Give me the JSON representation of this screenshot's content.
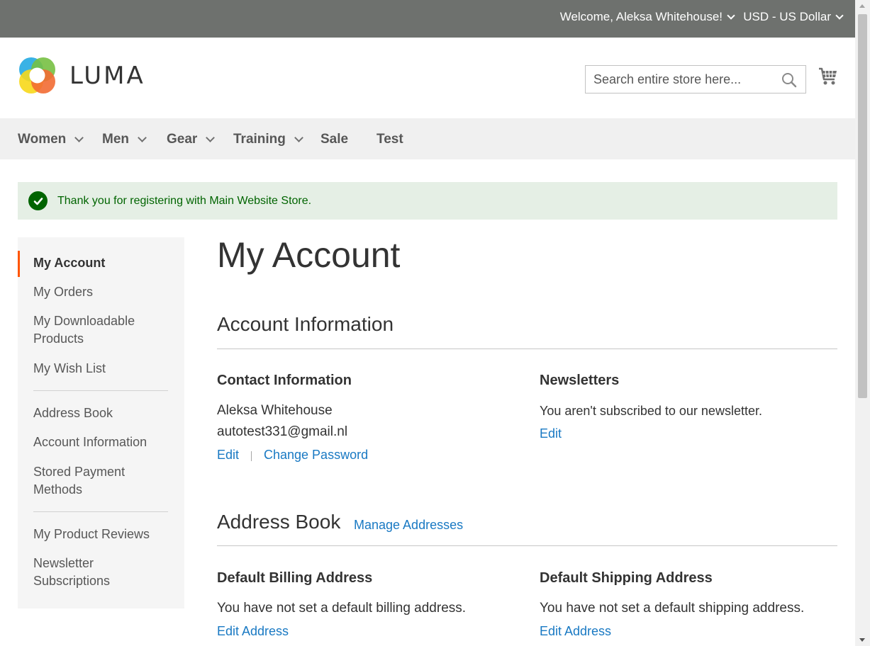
{
  "panel": {
    "welcome_label": "Welcome, Aleksa Whitehouse!",
    "currency_label": "USD - US Dollar"
  },
  "header": {
    "logo_text": "LUMA",
    "search_placeholder": "Search entire store here..."
  },
  "nav": {
    "items": [
      {
        "label": "Women"
      },
      {
        "label": "Men"
      },
      {
        "label": "Gear"
      },
      {
        "label": "Training"
      },
      {
        "label": "Sale"
      },
      {
        "label": "Test"
      }
    ]
  },
  "message": {
    "text": "Thank you for registering with Main Website Store."
  },
  "sidebar": {
    "items": [
      {
        "label": "My Account"
      },
      {
        "label": "My Orders"
      },
      {
        "label": "My Downloadable Products"
      },
      {
        "label": "My Wish List"
      },
      {
        "label": "Address Book"
      },
      {
        "label": "Account Information"
      },
      {
        "label": "Stored Payment Methods"
      },
      {
        "label": "My Product Reviews"
      },
      {
        "label": "Newsletter Subscriptions"
      }
    ]
  },
  "main": {
    "page_title": "My Account",
    "account_info": {
      "title": "Account Information",
      "contact": {
        "title": "Contact Information",
        "name": "Aleksa Whitehouse",
        "email": "autotest331@gmail.nl",
        "edit_label": "Edit",
        "change_password_label": "Change Password"
      },
      "newsletters": {
        "title": "Newsletters",
        "text": "You aren't subscribed to our newsletter.",
        "edit_label": "Edit"
      }
    },
    "address_book": {
      "title": "Address Book",
      "manage_label": "Manage Addresses",
      "billing": {
        "title": "Default Billing Address",
        "text": "You have not set a default billing address.",
        "edit_label": "Edit Address"
      },
      "shipping": {
        "title": "Default Shipping Address",
        "text": "You have not set a default shipping address.",
        "edit_label": "Edit Address"
      }
    }
  },
  "colors": {
    "panel_bg": "#6e716e",
    "link": "#1979c3",
    "success_bg": "#e5efe5",
    "success_text": "#006400",
    "current_marker": "#ff5501"
  }
}
